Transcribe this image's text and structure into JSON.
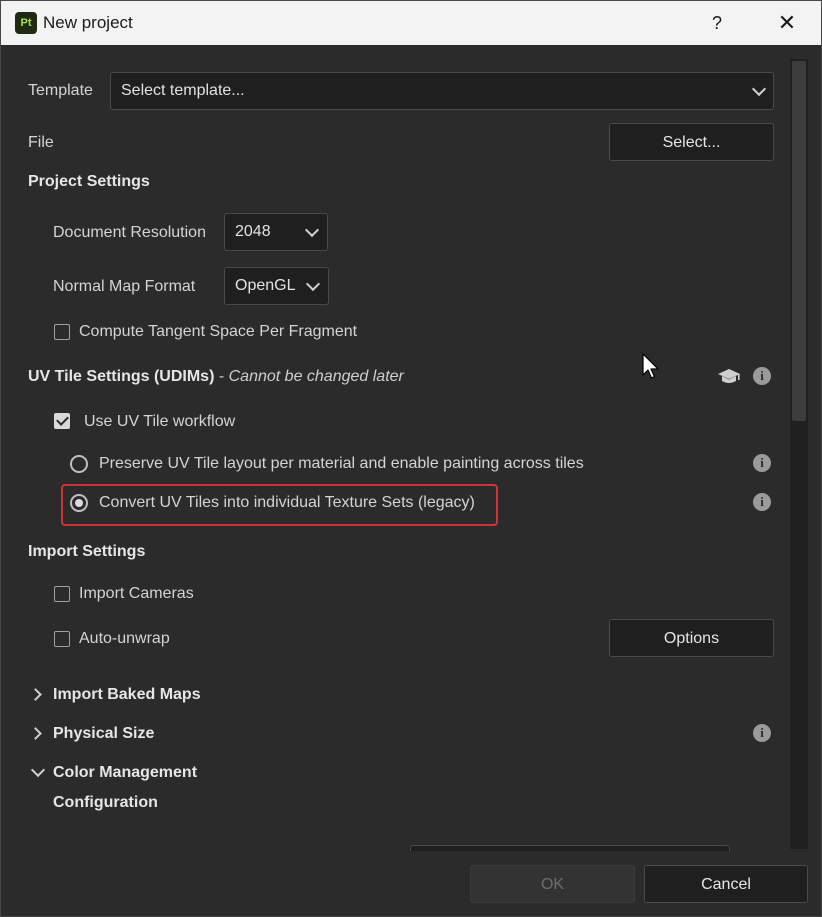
{
  "window": {
    "title": "New project",
    "app_icon_text": "Pt",
    "help_glyph": "?",
    "close_glyph": "✕"
  },
  "template": {
    "label": "Template",
    "value": "Select template..."
  },
  "file": {
    "label": "File",
    "button": "Select..."
  },
  "project_settings": {
    "header": "Project Settings",
    "resolution": {
      "label": "Document Resolution",
      "value": "2048"
    },
    "normal_map": {
      "label": "Normal Map Format",
      "value": "OpenGL"
    },
    "tangent": {
      "label": "Compute Tangent Space Per Fragment",
      "checked": false
    }
  },
  "uv_tile": {
    "header": "UV Tile Settings (UDIMs)",
    "dash": "-",
    "note": "Cannot be changed later",
    "workflow": {
      "label": "Use UV Tile workflow",
      "checked": true
    },
    "option_preserve": {
      "label": "Preserve UV Tile layout per material and enable painting across tiles",
      "selected": false
    },
    "option_convert": {
      "label": "Convert UV Tiles into individual Texture Sets (legacy)",
      "selected": true
    },
    "highlight_color": "#d0343a"
  },
  "import_settings": {
    "header": "Import Settings",
    "cameras": {
      "label": "Import Cameras",
      "checked": false
    },
    "unwrap": {
      "label": "Auto-unwrap",
      "checked": false
    },
    "options_button": "Options"
  },
  "sections": {
    "baked_maps": "Import Baked Maps",
    "physical_size": "Physical Size",
    "color_management": "Color Management",
    "configuration": "Configuration"
  },
  "footer": {
    "ok": "OK",
    "cancel": "Cancel"
  },
  "info_glyph": "i"
}
